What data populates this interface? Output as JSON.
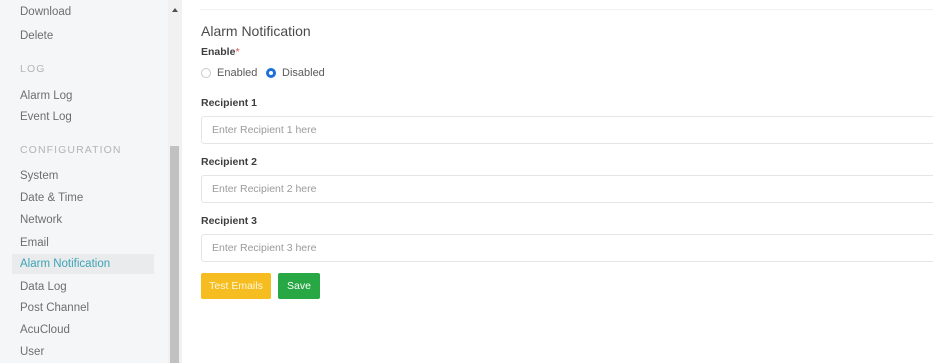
{
  "sidebar": {
    "items": [
      {
        "label": "Download"
      },
      {
        "label": "Delete"
      },
      {
        "section": "LOG"
      },
      {
        "label": "Alarm Log"
      },
      {
        "label": "Event Log"
      },
      {
        "section": "CONFIGURATION"
      },
      {
        "label": "System"
      },
      {
        "label": "Date & Time"
      },
      {
        "label": "Network"
      },
      {
        "label": "Email"
      },
      {
        "label": "Alarm Notification",
        "active": true
      },
      {
        "label": "Data Log"
      },
      {
        "label": "Post Channel"
      },
      {
        "label": "AcuCloud"
      },
      {
        "label": "User"
      }
    ]
  },
  "colors": {
    "active_item": "#3fa3b6",
    "radio_selected": "#1e6fd9",
    "test_button": "#f5bd1f",
    "save_button": "#28a745"
  },
  "main": {
    "title": "Alarm Notification",
    "enable": {
      "label": "Enable",
      "required_mark": "*",
      "options": [
        {
          "label": "Enabled",
          "selected": false
        },
        {
          "label": "Disabled",
          "selected": true
        }
      ]
    },
    "recipients": [
      {
        "label": "Recipient 1",
        "value": "",
        "placeholder": "Enter Recipient 1 here"
      },
      {
        "label": "Recipient 2",
        "value": "",
        "placeholder": "Enter Recipient 2 here"
      },
      {
        "label": "Recipient 3",
        "value": "",
        "placeholder": "Enter Recipient 3 here"
      }
    ],
    "buttons": {
      "test_emails": "Test Emails",
      "save": "Save"
    }
  }
}
